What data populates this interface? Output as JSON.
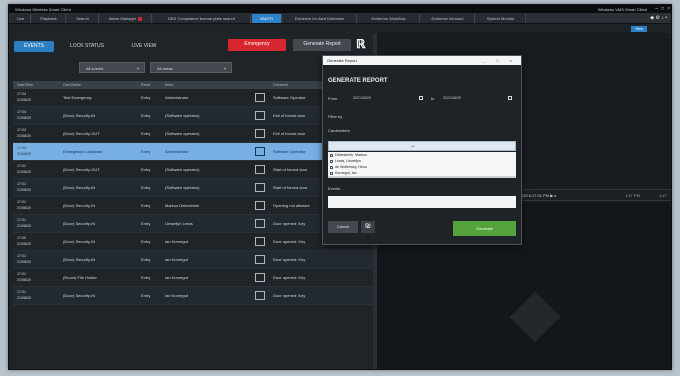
{
  "titlebar": {
    "title": "Windows Wireless Smart Client",
    "right": "Windows VMS Smart Client"
  },
  "tabs": [
    {
      "label": "Live"
    },
    {
      "label": "Playback"
    },
    {
      "label": "Search"
    },
    {
      "label": "Alarm Manager"
    },
    {
      "label": "DBS Compliance license plate search"
    },
    {
      "label": "VADTR"
    },
    {
      "label": "Evidence for Alert Detection"
    },
    {
      "label": "Evidence Workflow"
    },
    {
      "label": "Evidence Inbound"
    },
    {
      "label": "System Monitor"
    }
  ],
  "tabs_right": "◆ ⚙ ↓ •",
  "subbar_view": "View",
  "left": {
    "events_btn": "EVENTS",
    "lock_btn": "LOCK STATUS",
    "live_btn": "LIVE VIEW",
    "emergency_btn": "Emergency",
    "generate_btn": "Generate Report",
    "filter1": "All events",
    "filter2": "All areas",
    "columns": [
      "Date/Time",
      "Card Name",
      "Event",
      "Actor",
      "",
      "Comment"
    ],
    "rows": [
      {
        "d1": "17:04",
        "d2": "21/08/20",
        "c2": "Test Emergency",
        "c3": "Entry",
        "c4": "Administrator",
        "c6": "Software Operator"
      },
      {
        "d1": "17:04",
        "d2": "21/08/20",
        "c2": "(Door) Security-IN",
        "c3": "Entry",
        "c4": "(Software operator)",
        "c6": "Exit of forced door"
      },
      {
        "d1": "17:03",
        "d2": "21/08/20",
        "c2": "(Door) Security-OUT",
        "c3": "Entry",
        "c4": "(Software operator)",
        "c6": "Exit of forced door"
      },
      {
        "d1": "17:03",
        "d2": "21/08/20",
        "c2": "Emergency Lockdown",
        "c3": "Entry",
        "c4": "Administrator",
        "c6": "Software Operator"
      },
      {
        "d1": "17:01",
        "d2": "21/08/20",
        "c2": "(Door) Security-OUT",
        "c3": "Entry",
        "c4": "(Software operator)",
        "c6": "Start of forced door"
      },
      {
        "d1": "17:01",
        "d2": "21/08/20",
        "c2": "(Door) Security-IN",
        "c3": "Entry",
        "c4": "(Software operator)",
        "c6": "Start of forced door"
      },
      {
        "d1": "17:01",
        "d2": "21/08/20",
        "c2": "(Door) Security-IN",
        "c3": "Entry",
        "c4": "Markus Dekesbrink",
        "c6": "Opening not allowed"
      },
      {
        "d1": "17:01",
        "d2": "21/08/20",
        "c2": "(Door) Security-IN",
        "c3": "Entry",
        "c4": "Llewellyn Lewis",
        "c6": "Door opened: Key"
      },
      {
        "d1": "17:00",
        "d2": "21/08/20",
        "c2": "(Door) Security-IN",
        "c3": "Entry",
        "c4": "Ian Kornegut",
        "c6": "Door opened: Key"
      },
      {
        "d1": "17:01",
        "d2": "21/08/20",
        "c2": "(Door) Security-IN",
        "c3": "Entry",
        "c4": "Ian Kornegut",
        "c6": "Door opened: Key"
      },
      {
        "d1": "17:01",
        "d2": "21/08/20",
        "c2": "(Room) File Holder",
        "c3": "Entry",
        "c4": "Ian Kornegut",
        "c6": "Door opened: Key"
      },
      {
        "d1": "17:01",
        "d2": "21/08/20",
        "c2": "(Door) Security-IN",
        "c3": "Entry",
        "c4": "Ian Kornegut",
        "c6": "Door opened: Key"
      }
    ]
  },
  "timeline": {
    "time": "1/1/2020 6:17:01 PM ▶ ▸",
    "m1": "1:47 PM",
    "m2": "1:47"
  },
  "dialog": {
    "title": "Generate Report",
    "controls": "_ □ ×",
    "heading": "GENERATE REPORT",
    "from_label": "From",
    "from_value": "2021/08/09",
    "to_label": "to",
    "to_value": "2021/08/09",
    "filter_label": "Filter by",
    "cardholders_label": "Cardholders",
    "cardholders": [
      "Dekesbrink, Markus",
      "Lewis, Llewellyn",
      "de Wolfensky, Hiroo",
      "Kornegut, Ian"
    ],
    "events_label": "Events",
    "cancel": "Cancel",
    "generate": "Generate"
  }
}
